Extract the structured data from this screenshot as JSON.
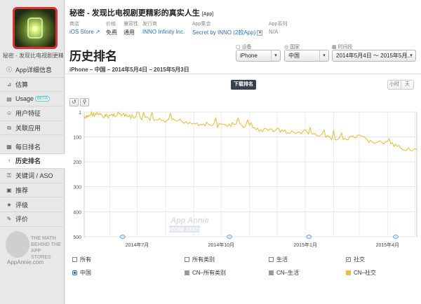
{
  "sidebar": {
    "app_name": "秘密 - 发现比电视剧更精...",
    "menu": [
      {
        "label": "App详细信息",
        "icon": "info-icon"
      },
      {
        "label": "估算",
        "icon": "chart-line-icon"
      },
      {
        "label": "Usage",
        "icon": "usage-icon",
        "badge": "BETA"
      },
      {
        "label": "用户特征",
        "icon": "user-icon"
      },
      {
        "label": "关联应用",
        "icon": "link-icon"
      },
      {
        "label": "每日排名",
        "icon": "calendar-icon"
      },
      {
        "label": "历史排名",
        "icon": "arrow-up-icon"
      },
      {
        "label": "关键词 / ASO",
        "icon": "key-icon"
      },
      {
        "label": "推荐",
        "icon": "feature-icon"
      },
      {
        "label": "评级",
        "icon": "star-icon"
      },
      {
        "label": "评价",
        "icon": "comment-icon"
      }
    ],
    "brand_tagline": "THE MATH BEHIND THE APP STORES",
    "brand_url": "AppAnnie.com"
  },
  "header": {
    "title": "秘密 - 发现比电视剧更精彩的真实人生",
    "title_tag": "[App]",
    "meta": {
      "store_label": "商店",
      "store_value": "iOS Store",
      "price_label": "价格",
      "price_value": "免费",
      "category_label": "兼容性",
      "category_value": "通用",
      "publisher_label": "发行商",
      "publisher_value": "INNO Infinity Inc.",
      "collection_label": "App集合",
      "collection_value": "Secret by INNO (2款App)",
      "series_label": "App系列",
      "series_value": "N/A"
    }
  },
  "page_title": "历史排名",
  "filters": {
    "device_label": "设备",
    "device_value": "iPhone",
    "country_label": "国家",
    "country_value": "中国",
    "range_label": "时间段",
    "range_value": "2014年5月4日 ～ 2015年5月..."
  },
  "subtitle": "iPhone – 中国 – 2014年5月4日 – 2015年5月3日",
  "buttons": {
    "download": "下载排名",
    "hour": "小时",
    "day": "天"
  },
  "watermark": {
    "line1": "App Annie",
    "line2": "STORE STATS"
  },
  "chart_data": {
    "type": "line",
    "yaxis_reversed": true,
    "ylim": [
      1,
      500
    ],
    "yticks": [
      1,
      100,
      200,
      300,
      400,
      500
    ],
    "xticks": [
      "2014年7月",
      "2014年10月",
      "2015年1月",
      "2015年4月"
    ],
    "series": [
      {
        "name": "CN–社交",
        "color": "#e7c043",
        "x": [
          "2014-05-04",
          "2014-05-10",
          "2014-05-18",
          "2014-05-25",
          "2014-06-01",
          "2014-06-10",
          "2014-06-20",
          "2014-07-01",
          "2014-07-15",
          "2014-08-01",
          "2014-08-15",
          "2014-09-01",
          "2014-09-15",
          "2014-10-01",
          "2014-10-15",
          "2014-11-01",
          "2014-11-15",
          "2014-12-01",
          "2014-12-15",
          "2015-01-01",
          "2015-01-15",
          "2015-02-01",
          "2015-02-15",
          "2015-03-01",
          "2015-03-15",
          "2015-04-01",
          "2015-04-15",
          "2015-05-03"
        ],
        "values": [
          30,
          12,
          8,
          20,
          15,
          10,
          18,
          22,
          30,
          38,
          35,
          45,
          50,
          55,
          50,
          60,
          75,
          70,
          85,
          80,
          95,
          105,
          110,
          100,
          120,
          125,
          145,
          150
        ]
      }
    ],
    "legend": [
      {
        "label": "所有",
        "checked": false
      },
      {
        "label": "所有类别",
        "checked": false
      },
      {
        "label": "生活",
        "checked": false
      },
      {
        "label": "社交",
        "checked": true
      }
    ],
    "series_legend": [
      {
        "label": "中国",
        "color": "#2a6fb6",
        "kind": "radio"
      },
      {
        "label": "CN–所有类别",
        "color": "#9a9a9a",
        "kind": "swatch"
      },
      {
        "label": "CN–生活",
        "color": "#9a9a9a",
        "kind": "swatch"
      },
      {
        "label": "CN–社交",
        "color": "#e7c043",
        "kind": "swatch"
      }
    ]
  }
}
